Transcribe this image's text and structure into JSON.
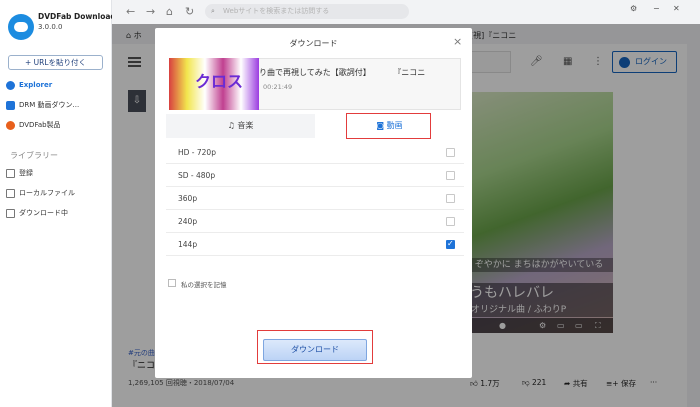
{
  "app": {
    "name": "DVDFab Downloader",
    "version": "3.0.0.0"
  },
  "sidebar": {
    "paste_url": "URLを貼り付く",
    "items": [
      {
        "label": "Explorer",
        "icon": "compass-icon",
        "color": "#1e73d8"
      },
      {
        "label": "DRM 動画ダウン...",
        "icon": "drm-icon",
        "color": "#1e73d8"
      },
      {
        "label": "DVDFab製品",
        "icon": "dvdfab-icon",
        "color": "#e8601c"
      }
    ],
    "library_heading": "ライブラリー",
    "library_items": [
      {
        "label": "登録",
        "icon": "subscribe-icon"
      },
      {
        "label": "ローカルファイル",
        "icon": "folder-icon"
      },
      {
        "label": "ダウンロード中",
        "icon": "download-icon"
      }
    ]
  },
  "browser": {
    "search_placeholder": "Webサイトを検索または訪問する",
    "page_title_right": "[視]『ニコニ",
    "page_title_left": "ホ"
  },
  "youtube": {
    "login_label": "ログイン"
  },
  "video": {
    "overlay_line1": "ぞやかに まちはかがやいている",
    "overlay_line2": "うもハレバレ",
    "overlay_line3": "オリジナル曲 / ふわりP",
    "tag": "#元の曲",
    "title": "『ニコ",
    "views": "1,269,105 回視聴・2018/07/04",
    "likes": "1.7万",
    "dislikes": "221",
    "share": "共有",
    "save": "保存"
  },
  "dialog": {
    "title": "ダウンロード",
    "close": "×",
    "media_name": "り曲で再視してみた【歌詞付】 『ニコニ",
    "duration": "00:21:49",
    "thumb_text": "クロス",
    "tab_audio": "音楽",
    "tab_video": "動画",
    "qualities": [
      {
        "label": "HD - 720p",
        "checked": false
      },
      {
        "label": "SD - 480p",
        "checked": false
      },
      {
        "label": "360p",
        "checked": false
      },
      {
        "label": "240p",
        "checked": false
      },
      {
        "label": "144p",
        "checked": true
      }
    ],
    "remember_label": "私の選択を記憶",
    "download_button": "ダウンロード"
  },
  "colors": {
    "accent": "#1e73d8",
    "highlight": "#e23c3c"
  }
}
